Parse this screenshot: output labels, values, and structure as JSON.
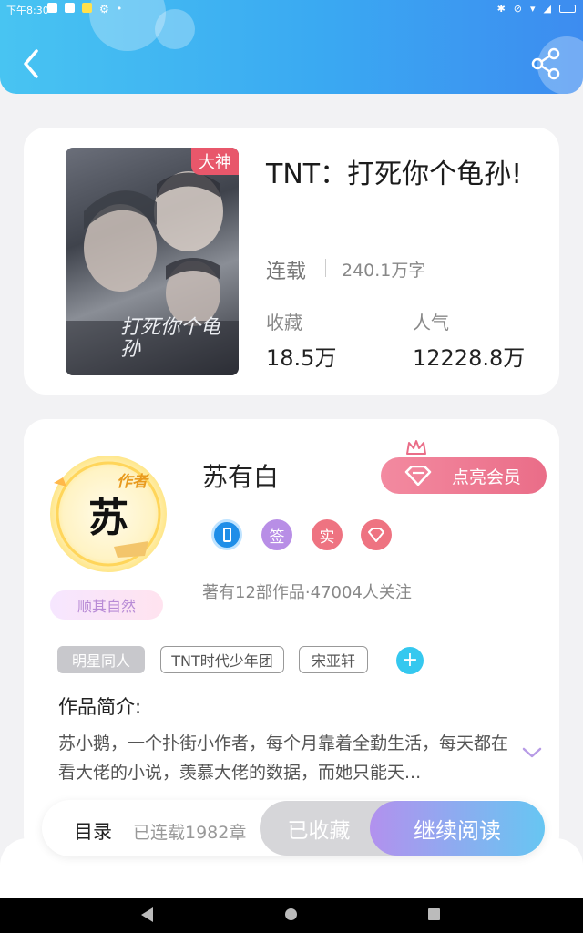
{
  "status_bar": {
    "time": "下午8:30"
  },
  "book": {
    "title": "TNT：打死你个龟孙!",
    "cover_badge": "大神",
    "cover_title": "打死你个龟孙",
    "serial_status": "连载",
    "word_count": "240.1万字",
    "favorites_label": "收藏",
    "favorites_value": "18.5万",
    "popularity_label": "人气",
    "popularity_value": "12228.8万"
  },
  "author": {
    "avatar_char": "苏",
    "role_tag": "作者",
    "motto": "顺其自然",
    "name": "苏有白",
    "vip_button": "点亮会员",
    "badges": {
      "signed": "签",
      "verified": "实"
    },
    "stats": "著有12部作品·47004人关注"
  },
  "tags": [
    "明星同人",
    "TNT时代少年团",
    "宋亚轩"
  ],
  "intro": {
    "heading": "作品简介:",
    "text": "苏小鹅，一个扑街小作者，每个月靠着全勤生活，每天都在看大佬的小说，羡慕大佬的数据，而她只能天..."
  },
  "bottom_bar": {
    "toc_label": "目录",
    "chapters_text": "已连载1982章",
    "collected_label": "已收藏",
    "read_label": "继续阅读"
  },
  "colors": {
    "header": "#3aa9f2",
    "accent_cyan": "#35c8ef",
    "vip_pink": "#ea6d88",
    "cover_badge": "#e8576b",
    "read_gradient_start": "#b291ee",
    "read_gradient_end": "#67c6f2"
  },
  "icons": {
    "back": "back-arrow-icon",
    "share": "share-icon",
    "crown": "crown-icon",
    "diamond": "diamond-icon",
    "expand": "chevron-down-icon",
    "add": "plus-icon"
  }
}
